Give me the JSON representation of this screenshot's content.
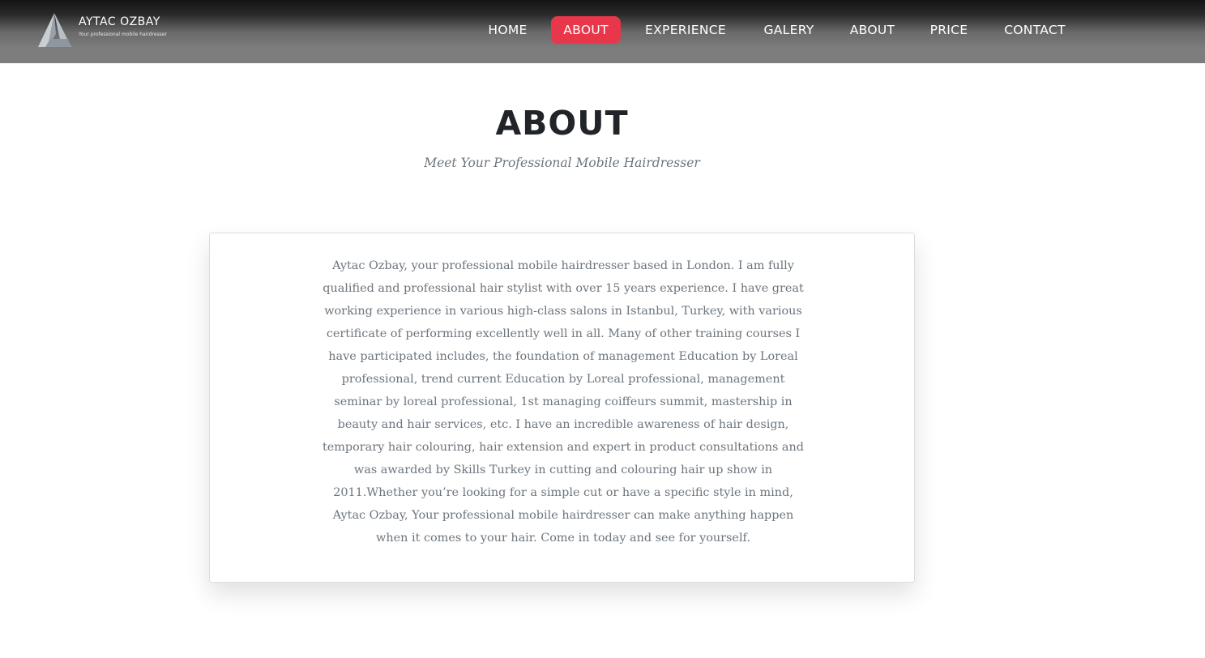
{
  "header": {
    "logo_title": "AYTAC OZBAY",
    "logo_tagline": "Your professional mobile hairdresser",
    "logo_icon": "triangle-a-logo-icon",
    "nav": [
      {
        "label": "HOME",
        "active": false
      },
      {
        "label": "ABOUT",
        "active": true
      },
      {
        "label": "EXPERIENCE",
        "active": false
      },
      {
        "label": "GALERY",
        "active": false
      },
      {
        "label": "ABOUT",
        "active": false
      },
      {
        "label": "PRICE",
        "active": false
      },
      {
        "label": "CONTACT",
        "active": false
      }
    ]
  },
  "about": {
    "title": "ABOUT",
    "subtitle": "Meet Your Professional Mobile Hairdresser",
    "body": "Aytac Ozbay, your professional mobile hairdresser based in London. I am fully qualified and professional hair stylist with over 15 years experience. I have great working experience in various high-class salons in Istanbul, Turkey, with various certificate of performing excellently well in all. Many of other training courses I have participated includes, the foundation of management Education by Loreal professional, trend current Education by Loreal professional, management seminar by loreal professional, 1st managing coiffeurs summit, mastership in beauty and hair services, etc. I have an incredible awareness of hair design, temporary hair colouring, hair extension and expert in product consultations and was awarded by Skills Turkey in cutting and colouring hair up show in 2011.Whether you’re looking for a simple cut or have a specific style in mind, Aytac Ozbay, Your professional mobile hairdresser can make anything happen when it comes to your hair. Come in today and see for yourself."
  },
  "colors": {
    "accent": "#e8374a",
    "heading": "#212529",
    "muted_text": "#6c757d"
  }
}
